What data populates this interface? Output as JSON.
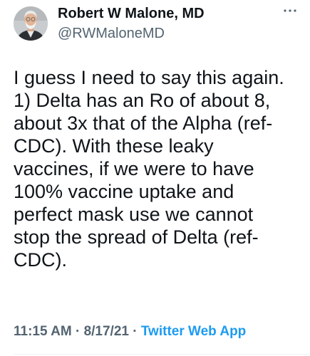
{
  "author": {
    "name": "Robert W Malone, MD",
    "handle": "@RWMaloneMD",
    "avatar_icon": "profile-photo"
  },
  "more_icon": "ellipsis-icon",
  "tweet": {
    "lines": [
      "I guess I need to say this again.",
      "1) Delta has an Ro of about 8,",
      "about 3x that of the Alpha (ref-",
      "CDC).  With these leaky",
      "vaccines, if we were to have",
      "100% vaccine uptake and",
      "perfect mask use we cannot",
      "stop the spread of Delta (ref-",
      "CDC)."
    ]
  },
  "meta": {
    "time": "11:15 AM",
    "separator": "·",
    "date": "8/17/21",
    "source": "Twitter Web App"
  },
  "colors": {
    "text": "#0f1419",
    "secondary": "#536471",
    "accent": "#1d9bf0"
  }
}
